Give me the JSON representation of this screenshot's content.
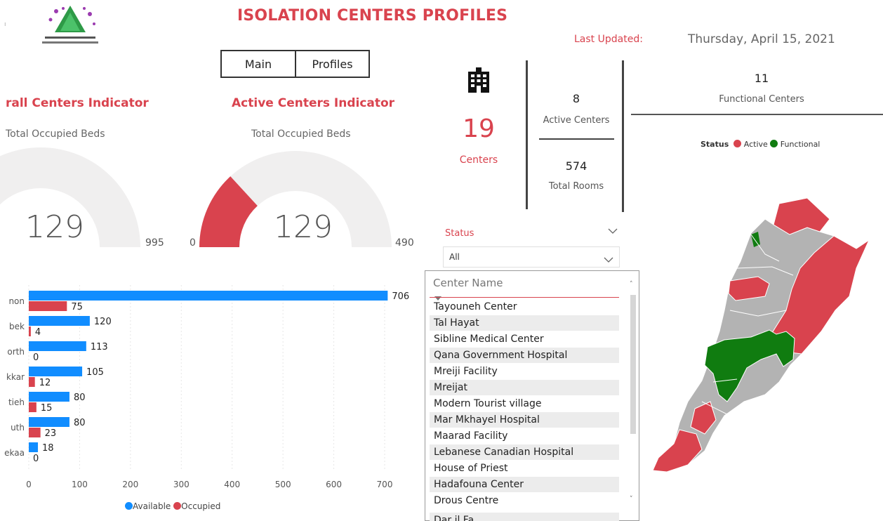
{
  "header": {
    "title": "ISOLATION CENTERS PROFILES",
    "last_updated_label": "Last Updated:",
    "last_updated_value": "Thursday, April 15, 2021"
  },
  "nav": {
    "main_label": "Main",
    "profiles_label": "Profiles"
  },
  "gauges": [
    {
      "title": "rall Centers Indicator",
      "subtitle": "Total Occupied Beds",
      "value": "129",
      "max": "995",
      "fraction": 0.1296
    },
    {
      "title": "Active Centers Indicator",
      "subtitle": "Total Occupied Beds",
      "value": "129",
      "min": "0",
      "max": "490",
      "fraction": 0.2633
    }
  ],
  "kpis": {
    "icon": "building-icon",
    "centers_value": "19",
    "centers_label": "Centers",
    "active_value": "8",
    "active_label": "Active Centers",
    "rooms_value": "574",
    "rooms_label": "Total Rooms",
    "functional_value": "11",
    "functional_label": "Functional Centers"
  },
  "map_legend": {
    "title": "Status",
    "items": [
      {
        "label": "Active",
        "color": "#d9434e"
      },
      {
        "label": "Functional",
        "color": "#107c10"
      }
    ]
  },
  "status_filter": {
    "label": "Status",
    "value": "All"
  },
  "center_list": {
    "header": "Center Name",
    "items": [
      "Tayouneh Center",
      "Tal Hayat",
      "Sibline Medical Center",
      "Qana Government Hospital",
      "Mreiji Facility",
      "Mreijat",
      "Modern Tourist village",
      "Mar Mkhayel Hospital",
      "Maarad Facility",
      "Lebanese Canadian Hospital",
      "House of Priest",
      "Hadafouna Center",
      "Drous Centre"
    ]
  },
  "colors": {
    "available": "#118dff",
    "occupied": "#d9434e",
    "functional": "#107c10",
    "inactive": "#b3b3b3"
  },
  "chart_data": {
    "type": "bar",
    "orientation": "horizontal",
    "categories": [
      "non",
      "bek",
      "orth",
      "kkar",
      "tieh",
      "uth",
      "ekaa"
    ],
    "series": [
      {
        "name": "Available",
        "values": [
          706,
          120,
          113,
          105,
          80,
          80,
          18
        ]
      },
      {
        "name": "Occupied",
        "values": [
          75,
          4,
          0,
          12,
          15,
          23,
          0
        ]
      }
    ],
    "xlim": [
      0,
      700
    ],
    "xticks": [
      0,
      100,
      200,
      300,
      400,
      500,
      600,
      700
    ],
    "grid": true,
    "legend": "bottom"
  }
}
